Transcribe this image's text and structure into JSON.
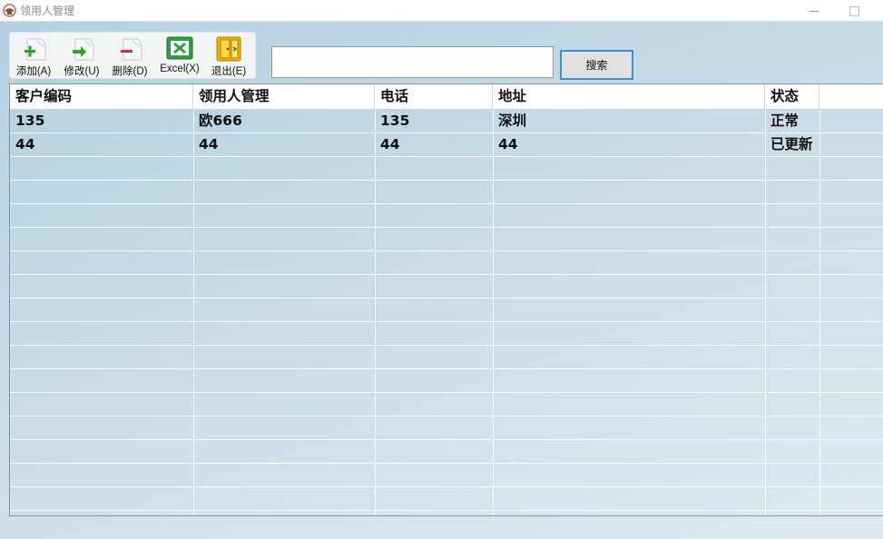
{
  "window": {
    "title": "领用人管理",
    "icon": "app-logo-icon"
  },
  "toolbar": {
    "items": [
      {
        "label": "添加(A)",
        "icon": "add-icon"
      },
      {
        "label": "修改(U)",
        "icon": "edit-icon"
      },
      {
        "label": "删除(D)",
        "icon": "delete-icon"
      },
      {
        "label": "Excel(X)",
        "icon": "excel-icon"
      },
      {
        "label": "退出(E)",
        "icon": "exit-icon"
      }
    ]
  },
  "search": {
    "value": "",
    "button_label": "搜索"
  },
  "table": {
    "columns": [
      "客户编码",
      "领用人管理",
      "电话",
      "地址",
      "状态"
    ],
    "rows": [
      [
        "135",
        "欧666",
        "135",
        "深圳",
        "正常"
      ],
      [
        "44",
        "44",
        "44",
        "44",
        "已更新"
      ]
    ]
  },
  "colors": {
    "accent": "#3d8fd6",
    "background": "#c8dce7"
  }
}
